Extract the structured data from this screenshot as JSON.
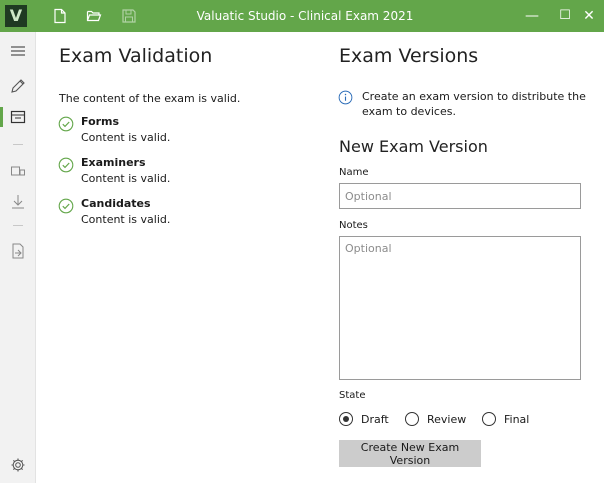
{
  "window": {
    "title": "Valuatic Studio - Clinical Exam 2021",
    "logo_letter": "V",
    "minimize_glyph": "—",
    "maximize_glyph": "☐",
    "close_glyph": "✕"
  },
  "toolbar_icons": [
    "new-document-icon",
    "open-folder-icon",
    "save-icon"
  ],
  "sidebar": {
    "items": [
      "hamburger-menu-icon",
      "pencil-icon",
      "inbox-icon",
      "devices-icon",
      "download-icon",
      "export-icon",
      "settings-icon"
    ],
    "active": "inbox-icon"
  },
  "validation": {
    "heading": "Exam Validation",
    "summary": "The content of the exam is valid.",
    "items": [
      {
        "title": "Forms",
        "status": "Content is valid."
      },
      {
        "title": "Examiners",
        "status": "Content is valid."
      },
      {
        "title": "Candidates",
        "status": "Content is valid."
      }
    ]
  },
  "versions": {
    "heading": "Exam Versions",
    "info_line1": "Create an exam version to distribute the",
    "info_line2": "exam to devices.",
    "new_heading": "New Exam Version",
    "name_label": "Name",
    "name_placeholder": "Optional",
    "name_value": "",
    "notes_label": "Notes",
    "notes_placeholder": "Optional",
    "notes_value": "",
    "state_label": "State",
    "state_options": [
      "Draft",
      "Review",
      "Final"
    ],
    "state_selected": "Draft",
    "create_button": "Create New Exam Version"
  },
  "colors": {
    "accent": "#63a64a",
    "logo_bg": "#1f3a22",
    "sidebar_bg": "#f2f2f2",
    "button_bg": "#cccccc"
  }
}
